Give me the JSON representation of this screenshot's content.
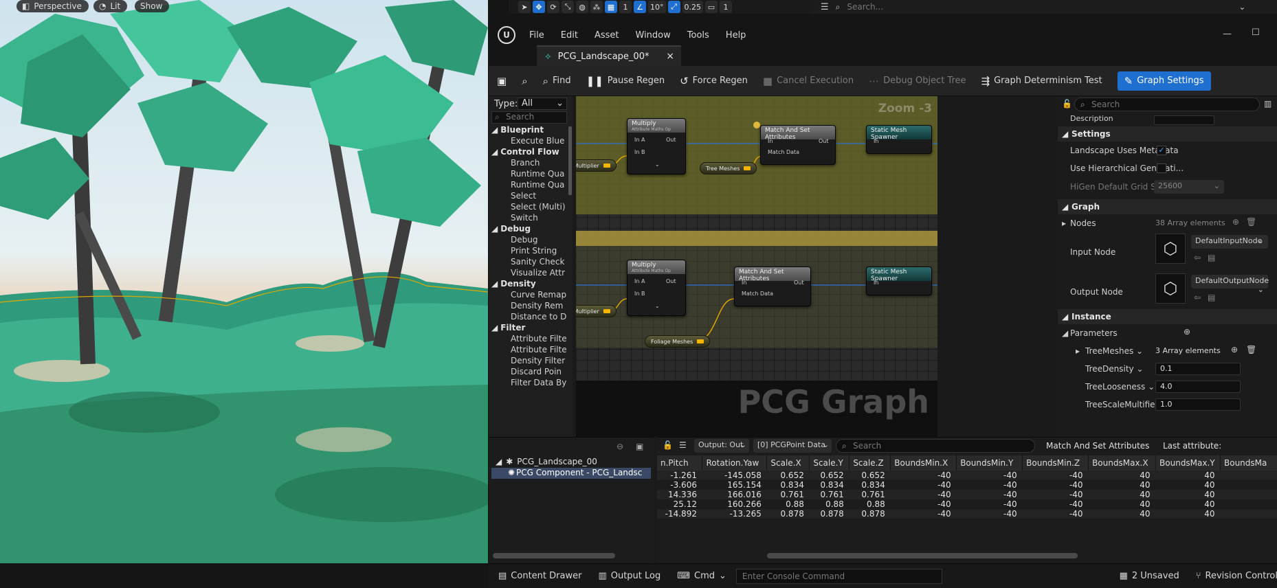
{
  "viewport": {
    "mode": "Perspective",
    "lit": "Lit",
    "show": "Show"
  },
  "top_toolbar": {
    "num_a": "1",
    "angle": "10°",
    "scale": "0.25",
    "cam": "1"
  },
  "top_right": {
    "search_placeholder": "Search..."
  },
  "editor": {
    "menu": [
      "File",
      "Edit",
      "Asset",
      "Window",
      "Tools",
      "Help"
    ],
    "tab": {
      "title": "PCG_Landscape_00*",
      "close": "×"
    },
    "toolbar": {
      "find": "Find",
      "pause": "Pause Regen",
      "force": "Force Regen",
      "cancel": "Cancel Execution",
      "debug_tree": "Debug Object Tree",
      "determinism": "Graph Determinism Test",
      "settings": "Graph Settings"
    },
    "palette": {
      "type_label": "Type:",
      "type_value": "All",
      "search": "Search",
      "categories": [
        {
          "name": "Blueprint",
          "items": [
            "Execute Blue"
          ]
        },
        {
          "name": "Control Flow",
          "items": [
            "Branch",
            "Runtime Qua",
            "Runtime Qua",
            "Select",
            "Select (Multi)",
            "Switch"
          ]
        },
        {
          "name": "Debug",
          "items": [
            "Debug",
            "Print String",
            "Sanity Check",
            "Visualize Attr"
          ]
        },
        {
          "name": "Density",
          "items": [
            "Curve Remap",
            "Density Rem",
            "Distance to D"
          ]
        },
        {
          "name": "Filter",
          "items": [
            "Attribute Filte",
            "Attribute Filte",
            "Density Filter",
            "Discard Poin",
            "Filter Data By"
          ]
        }
      ]
    },
    "graph": {
      "zoom": "Zoom -3",
      "watermark": "PCG Graph",
      "multiply": "Multiply",
      "multiply_sub": "Attribute Maths Op",
      "in_a": "In A",
      "in_b": "In B",
      "out": "Out",
      "in": "In",
      "match": "Match And Set Attributes",
      "match_data": "Match Data",
      "spawner": "Static Mesh Spawner",
      "var_multiplier": "e Multiplier",
      "tree_meshes": "Tree Meshes",
      "foliage_meshes": "Foliage Meshes"
    },
    "details": {
      "search": "Search",
      "description": "Description",
      "settings": "Settings",
      "landscape_meta": "Landscape Uses Metadata",
      "hier_gen": "Use Hierarchical Generati...",
      "higen": "HiGen Default Grid Size",
      "higen_val": "25600",
      "graph": "Graph",
      "nodes": "Nodes",
      "nodes_val": "38 Array elements",
      "input_node": "Input Node",
      "input_val": "DefaultInputNode",
      "output_node": "Output Node",
      "output_val": "DefaultOutputNode",
      "instance": "Instance",
      "parameters": "Parameters",
      "tree_meshes": "TreeMeshes",
      "tree_meshes_val": "3 Array elements",
      "tree_density": "TreeDensity",
      "tree_density_val": "0.1",
      "tree_loose": "TreeLooseness",
      "tree_loose_val": "4.0",
      "tree_scale": "TreeScaleMultifier",
      "tree_scale_val": "1.0"
    },
    "outliner": {
      "root": "PCG_Landscape_00",
      "child": "PCG Component - PCG_Landsc"
    },
    "data": {
      "output": "Output: Out",
      "pin": "[0] PCGPoint Data",
      "search": "Search",
      "node": "Match And Set Attributes",
      "last": "Last attribute:",
      "columns": [
        "n.Pitch",
        "Rotation.Yaw",
        "Scale.X",
        "Scale.Y",
        "Scale.Z",
        "BoundsMin.X",
        "BoundsMin.Y",
        "BoundsMin.Z",
        "BoundsMax.X",
        "BoundsMax.Y",
        "BoundsMa"
      ],
      "rows": [
        [
          "-1.261",
          "-145.058",
          "0.652",
          "0.652",
          "0.652",
          "-40",
          "-40",
          "-40",
          "40",
          "40",
          ""
        ],
        [
          "-3.606",
          "165.154",
          "0.834",
          "0.834",
          "0.834",
          "-40",
          "-40",
          "-40",
          "40",
          "40",
          ""
        ],
        [
          "14.336",
          "166.016",
          "0.761",
          "0.761",
          "0.761",
          "-40",
          "-40",
          "-40",
          "40",
          "40",
          ""
        ],
        [
          "25.12",
          "160.266",
          "0.88",
          "0.88",
          "0.88",
          "-40",
          "-40",
          "-40",
          "40",
          "40",
          ""
        ],
        [
          "-14.892",
          "-13.265",
          "0.878",
          "0.878",
          "0.878",
          "-40",
          "-40",
          "-40",
          "40",
          "40",
          ""
        ]
      ]
    },
    "status": {
      "drawer": "Content Drawer",
      "log": "Output Log",
      "cmd": "Cmd",
      "console": "Enter Console Command",
      "unsaved": "2 Unsaved",
      "revision": "Revision Control"
    }
  }
}
